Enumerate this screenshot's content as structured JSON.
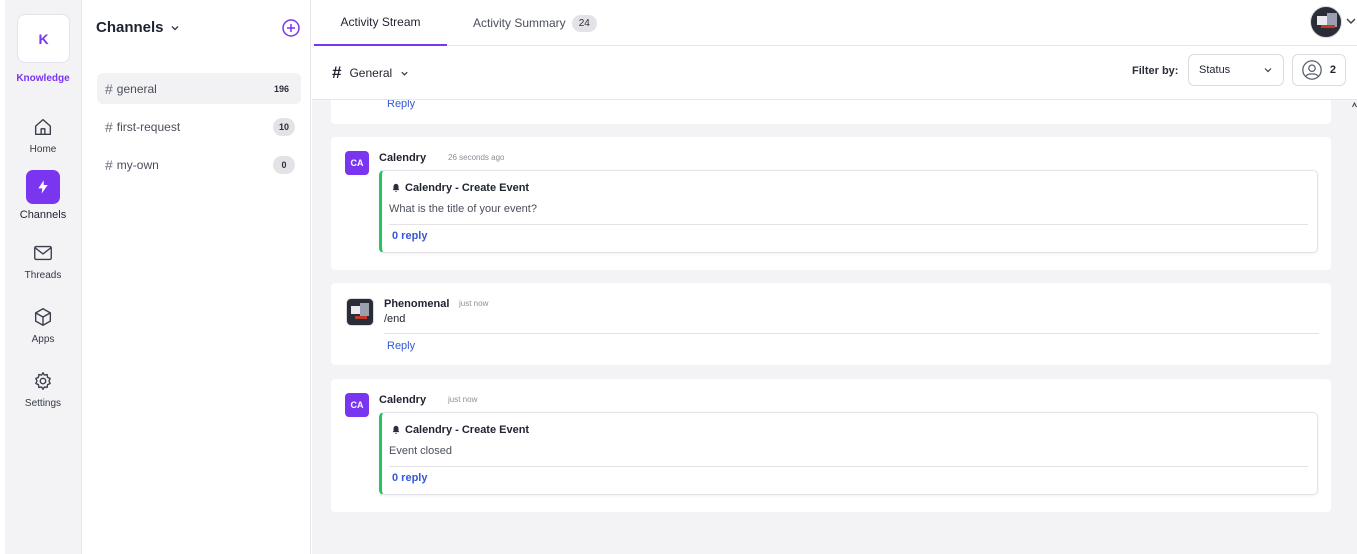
{
  "workspace": {
    "initial": "K",
    "name": "Knowledge"
  },
  "rail": {
    "items": [
      {
        "label": "Home",
        "icon": "home-icon"
      },
      {
        "label": "Channels",
        "icon": "bolt-icon",
        "active": true
      },
      {
        "label": "Threads",
        "icon": "mail-icon"
      },
      {
        "label": "Apps",
        "icon": "cube-icon"
      },
      {
        "label": "Settings",
        "icon": "gear-icon"
      }
    ]
  },
  "channels": {
    "title": "Channels",
    "items": [
      {
        "name": "general",
        "count": "196",
        "active": true
      },
      {
        "name": "first-request",
        "count": "10"
      },
      {
        "name": "my-own",
        "count": "0"
      }
    ]
  },
  "tabs": [
    {
      "label": "Activity Stream",
      "active": true
    },
    {
      "label": "Activity Summary",
      "count": "24"
    }
  ],
  "filterbar": {
    "channel": "General",
    "filter_label": "Filter by:",
    "status_value": "Status",
    "member_count": "2"
  },
  "stream": {
    "top_reply": "Reply",
    "cards": [
      {
        "avatar": "CA",
        "author": "Calendry",
        "time": "26 seconds ago",
        "title": "Calendry - Create Event",
        "body": "What is the title of your event?",
        "reply": "0 reply"
      },
      {
        "author": "Phenomenal",
        "time": "just now",
        "text": "/end",
        "reply": "Reply"
      },
      {
        "avatar": "CA",
        "author": "Calendry",
        "time": "just now",
        "title": "Calendry - Create Event",
        "body": "Event closed",
        "reply": "0 reply"
      }
    ]
  },
  "colors": {
    "accent": "#7a35f0",
    "link": "#3558d8",
    "success": "#22c55e"
  }
}
